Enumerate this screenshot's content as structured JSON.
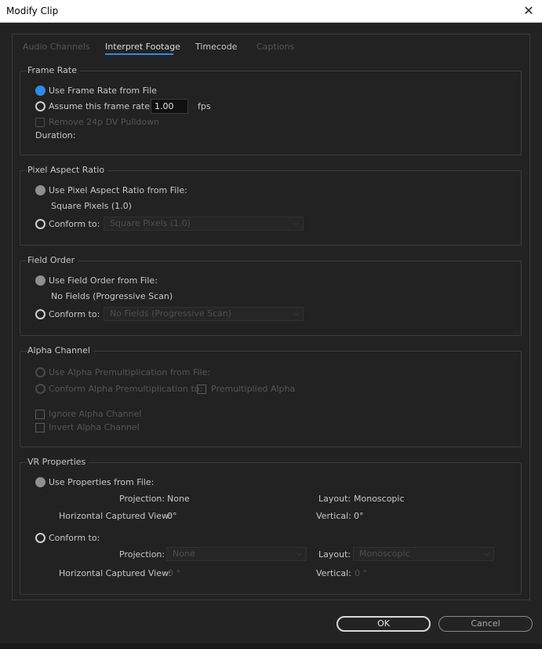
{
  "window": {
    "title": "Modify Clip",
    "close_glyph": "✕"
  },
  "tabs": [
    {
      "label": "Audio Channels",
      "state": "disabled"
    },
    {
      "label": "Interpret Footage",
      "state": "active"
    },
    {
      "label": "Timecode",
      "state": "normal"
    },
    {
      "label": "Captions",
      "state": "disabled"
    }
  ],
  "frame_rate": {
    "title": "Frame Rate",
    "use_file_label": "Use Frame Rate from File",
    "assume_label": "Assume this frame rate:",
    "assume_value": "1.00",
    "fps_label": "fps",
    "remove_pulldown_label": "Remove 24p DV Pulldown",
    "duration_label": "Duration:"
  },
  "pixel_aspect": {
    "title": "Pixel Aspect Ratio",
    "use_file_label": "Use Pixel Aspect Ratio from File:",
    "file_value": "Square Pixels (1.0)",
    "conform_label": "Conform to:",
    "conform_value": "Square Pixels (1.0)"
  },
  "field_order": {
    "title": "Field Order",
    "use_file_label": "Use Field Order from File:",
    "file_value": "No Fields (Progressive Scan)",
    "conform_label": "Conform to:",
    "conform_value": "No Fields (Progressive Scan)"
  },
  "alpha": {
    "title": "Alpha Channel",
    "use_premult_label": "Use Alpha Premultiplication from File:",
    "conform_premult_label": "Conform Alpha Premultiplication to:",
    "premultiplied_label": "Premultiplied Alpha",
    "ignore_label": "Ignore Alpha Channel",
    "invert_label": "Invert Alpha Channel"
  },
  "vr": {
    "title": "VR Properties",
    "use_file_label": "Use Properties from File:",
    "projection_label": "Projection:",
    "projection_value": "None",
    "layout_label": "Layout:",
    "layout_value": "Monoscopic",
    "hview_label": "Horizontal Captured View:",
    "hview_value": "0°",
    "vertical_label": "Vertical:",
    "vertical_value": "0°",
    "conform_label": "Conform to:",
    "conform_projection_value": "None",
    "conform_layout_value": "Monoscopic",
    "conform_hview_value": "0 °",
    "conform_vertical_value": "0 °"
  },
  "buttons": {
    "ok": "OK",
    "cancel": "Cancel"
  }
}
